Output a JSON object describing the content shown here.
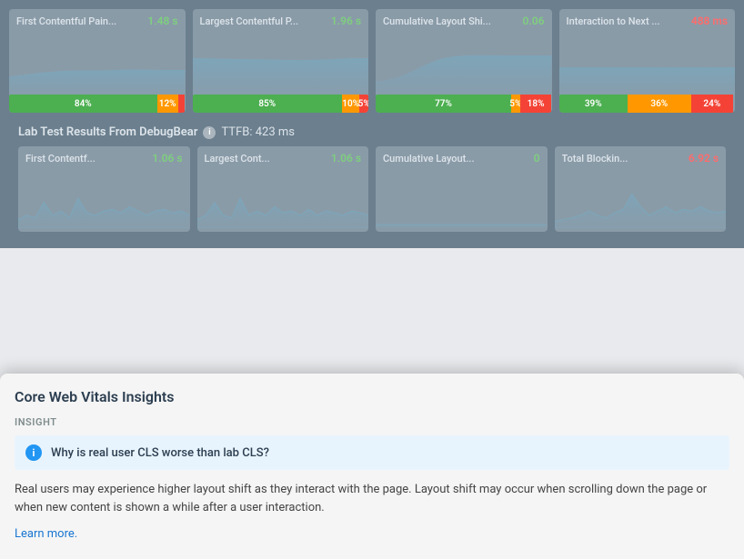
{
  "metrics": {
    "row1": [
      {
        "title": "First Contentful Pain...",
        "value": "1.48 s",
        "value_color": "green",
        "progress": [
          {
            "pct": 84,
            "label": "84%",
            "color": "green"
          },
          {
            "pct": 12,
            "label": "12%",
            "color": "orange"
          },
          {
            "pct": 4,
            "label": "",
            "color": "red"
          }
        ],
        "chart_type": "area_flat"
      },
      {
        "title": "Largest Contentful P...",
        "value": "1.96 s",
        "value_color": "green",
        "progress": [
          {
            "pct": 85,
            "label": "85%",
            "color": "green"
          },
          {
            "pct": 10,
            "label": "10%",
            "color": "orange"
          },
          {
            "pct": 5,
            "label": "5%",
            "color": "red"
          }
        ],
        "chart_type": "area_flat"
      },
      {
        "title": "Cumulative Layout Shi...",
        "value": "0.06",
        "value_color": "green",
        "progress": [
          {
            "pct": 77,
            "label": "77%",
            "color": "green"
          },
          {
            "pct": 5,
            "label": "5%",
            "color": "orange"
          },
          {
            "pct": 18,
            "label": "18%",
            "color": "red"
          }
        ],
        "chart_type": "area_bump"
      },
      {
        "title": "Interaction to Next ...",
        "value": "488 ms",
        "value_color": "red",
        "progress": [
          {
            "pct": 39,
            "label": "39%",
            "color": "green"
          },
          {
            "pct": 36,
            "label": "36%",
            "color": "orange"
          },
          {
            "pct": 24,
            "label": "24%",
            "color": "red"
          }
        ],
        "chart_type": "area_flat"
      }
    ],
    "lab": {
      "title": "Lab Test Results From DebugBear",
      "ttfb": "TTFB: 423 ms",
      "items": [
        {
          "title": "First Contentf...",
          "value": "1.06 s",
          "value_color": "green",
          "chart_type": "spiky_low"
        },
        {
          "title": "Largest Cont...",
          "value": "1.06 s",
          "value_color": "green",
          "chart_type": "spiky_low"
        },
        {
          "title": "Cumulative Layout...",
          "value": "0",
          "value_color": "green",
          "chart_type": "flat"
        },
        {
          "title": "Total Blockin...",
          "value": "6.92 s",
          "value_color": "red",
          "chart_type": "spiky_high"
        }
      ]
    }
  },
  "insights": {
    "panel_title": "Core Web Vitals Insights",
    "insight_label": "INSIGHT",
    "question": "Why is real user CLS worse than lab CLS?",
    "description": "Real users may experience higher layout shift as they interact with the page. Layout shift may occur when scrolling down the page or when new content is shown a while after a user interaction.",
    "learn_more": "Learn more.",
    "info_symbol": "i"
  }
}
